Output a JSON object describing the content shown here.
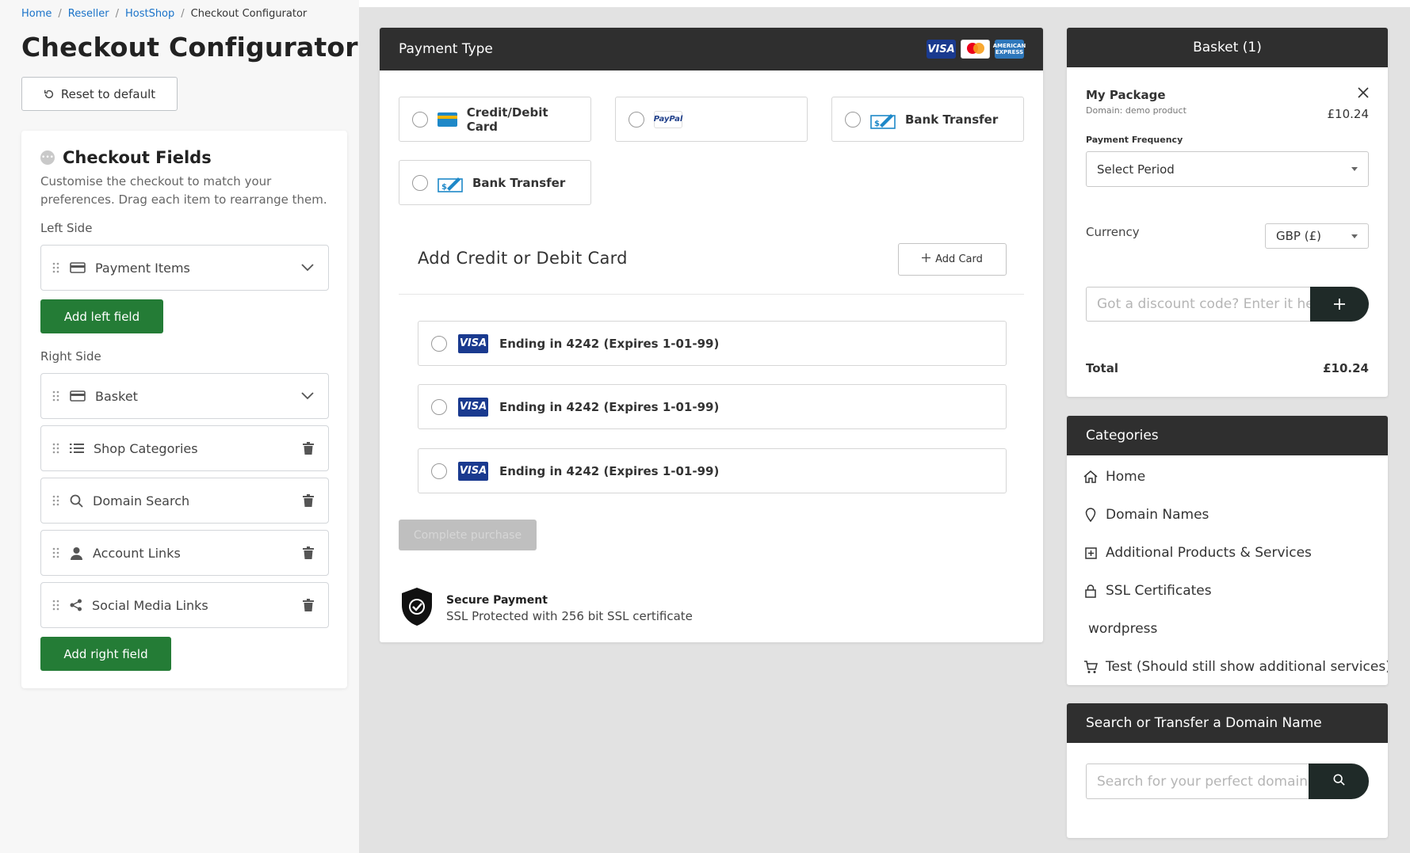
{
  "breadcrumb": {
    "items": [
      {
        "label": "Home"
      },
      {
        "label": "Reseller"
      },
      {
        "label": "HostShop"
      }
    ],
    "current": "Checkout Configurator",
    "separator": "/"
  },
  "page": {
    "title": "Checkout Configurator",
    "reset_label": "Reset to default"
  },
  "checkout_fields": {
    "title": "Checkout Fields",
    "description": "Customise the checkout to match your preferences. Drag each item to rearrange them.",
    "left_label": "Left Side",
    "left_items": [
      {
        "label": "Payment Items",
        "icon": "credit-card-icon",
        "end": "chevron-down-icon"
      }
    ],
    "add_left_label": "Add left field",
    "right_label": "Right Side",
    "right_items": [
      {
        "label": "Basket",
        "icon": "credit-card-icon",
        "end": "chevron-down-icon"
      },
      {
        "label": "Shop Categories",
        "icon": "list-icon",
        "end": "trash-icon"
      },
      {
        "label": "Domain Search",
        "icon": "search-icon",
        "end": "trash-icon"
      },
      {
        "label": "Account Links",
        "icon": "user-icon",
        "end": "trash-icon"
      },
      {
        "label": "Social Media Links",
        "icon": "share-icon",
        "end": "trash-icon"
      }
    ],
    "add_right_label": "Add right field"
  },
  "payment": {
    "header": "Payment Type",
    "card_logos": [
      "VISA",
      "MasterCard",
      "AMERICAN EXPRESS"
    ],
    "types": [
      {
        "label": "Credit/Debit Card",
        "icon": "credit-card-icon"
      },
      {
        "label": "",
        "icon": "paypal-icon",
        "logo_text": "PayPal"
      },
      {
        "label": "Bank Transfer",
        "icon": "bank-cheque-icon"
      },
      {
        "label": "Bank Transfer",
        "icon": "bank-cheque-icon"
      }
    ],
    "add_card_title": "Add Credit or Debit Card",
    "add_card_button": "Add Card",
    "saved_cards": [
      {
        "brand": "VISA",
        "label": "Ending in 4242 (Expires 1-01-99)"
      },
      {
        "brand": "VISA",
        "label": "Ending in 4242 (Expires 1-01-99)"
      },
      {
        "brand": "VISA",
        "label": "Ending in 4242 (Expires 1-01-99)"
      }
    ],
    "complete_label": "Complete purchase",
    "secure_title": "Secure Payment",
    "secure_subtitle": "SSL Protected with 256 bit SSL certificate"
  },
  "basket": {
    "title": "Basket (1)",
    "item_name": "My Package",
    "item_sub": "Domain: demo product",
    "item_price": "£10.24",
    "freq_label": "Payment Frequency",
    "freq_value": "Select Period",
    "currency_label": "Currency",
    "currency_value": "GBP (£)",
    "discount_placeholder": "Got a discount code? Enter it here",
    "total_label": "Total",
    "total_value": "£10.24"
  },
  "categories": {
    "title": "Categories",
    "items": [
      {
        "label": "Home",
        "icon": "home-icon"
      },
      {
        "label": "Domain Names",
        "icon": "map-pin-icon"
      },
      {
        "label": "Additional Products & Services",
        "icon": "plus-square-icon"
      },
      {
        "label": "SSL Certificates",
        "icon": "lock-icon"
      },
      {
        "label": "wordpress",
        "icon": ""
      },
      {
        "label": "Test (Should still show additional services)",
        "icon": "cart-icon"
      }
    ]
  },
  "domain_search": {
    "title": "Search or Transfer a Domain Name",
    "placeholder": "Search for your perfect domain"
  }
}
